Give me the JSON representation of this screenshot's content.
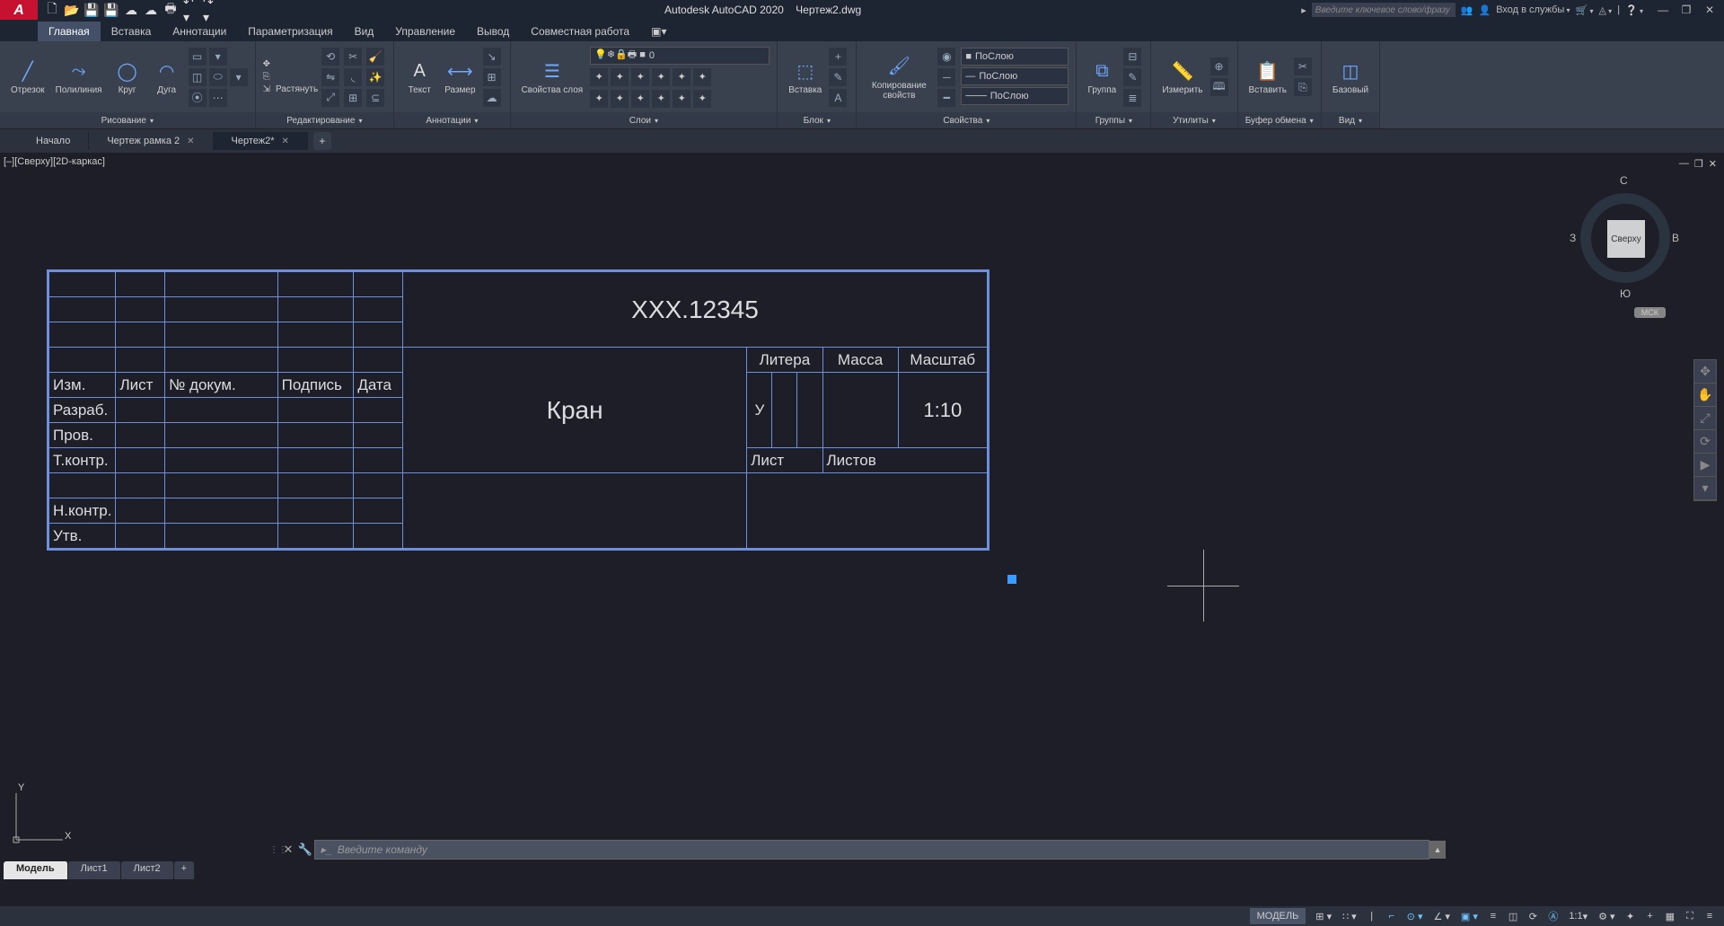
{
  "app": {
    "title": "Autodesk AutoCAD 2020",
    "file": "Чертеж2.dwg"
  },
  "search": {
    "placeholder": "Введите ключевое слово/фразу"
  },
  "signin": "Вход в службы",
  "ribbonTabs": [
    "Главная",
    "Вставка",
    "Аннотации",
    "Параметризация",
    "Вид",
    "Управление",
    "Вывод",
    "Совместная работа"
  ],
  "panels": {
    "draw": {
      "title": "Рисование",
      "line": "Отрезок",
      "polyline": "Полилиния",
      "circle": "Круг",
      "arc": "Дуга"
    },
    "edit": {
      "title": "Редактирование",
      "stretch": "Растянуть"
    },
    "annot": {
      "title": "Аннотации",
      "text": "Текст",
      "dim": "Размер"
    },
    "layers": {
      "title": "Слои",
      "props": "Свойства слоя",
      "current": "0"
    },
    "block": {
      "title": "Блок",
      "insert": "Вставка"
    },
    "props": {
      "title": "Свойства",
      "match": "Копирование свойств",
      "bylayer": "ПоСлою"
    },
    "groups": {
      "title": "Группы",
      "group": "Группа"
    },
    "utils": {
      "title": "Утилиты",
      "measure": "Измерить"
    },
    "clip": {
      "title": "Буфер обмена",
      "paste": "Вставить"
    },
    "view": {
      "title": "Вид",
      "base": "Базовый"
    }
  },
  "fileTabs": {
    "start": "Начало",
    "t1": "Чертеж рамка 2",
    "t2": "Чертеж2*"
  },
  "viewport": {
    "label": "[–][Сверху][2D-каркас]"
  },
  "viewcube": {
    "n": "С",
    "s": "Ю",
    "e": "В",
    "w": "З",
    "top": "Сверху",
    "wcs": "МСК"
  },
  "titleBlock": {
    "code": "XXX.12345",
    "name": "Кран",
    "izm": "Изм.",
    "list": "Лист",
    "ndoc": "№ докум.",
    "podpis": "Подпись",
    "data": "Дата",
    "razrab": "Разраб.",
    "prov": "Пров.",
    "tkontr": "Т.контр.",
    "nkontr": "Н.контр.",
    "utv": "Утв.",
    "litera": "Литера",
    "massa": "Масса",
    "masshtab": "Масштаб",
    "lit_u": "У",
    "scale": "1:10",
    "listLbl": "Лист",
    "listovLbl": "Листов"
  },
  "cmd": {
    "placeholder": "Введите команду"
  },
  "layoutTabs": {
    "model": "Модель",
    "l1": "Лист1",
    "l2": "Лист2"
  },
  "status": {
    "model": "МОДЕЛЬ",
    "scale": "1:1"
  },
  "ucs": {
    "x": "X",
    "y": "Y"
  }
}
